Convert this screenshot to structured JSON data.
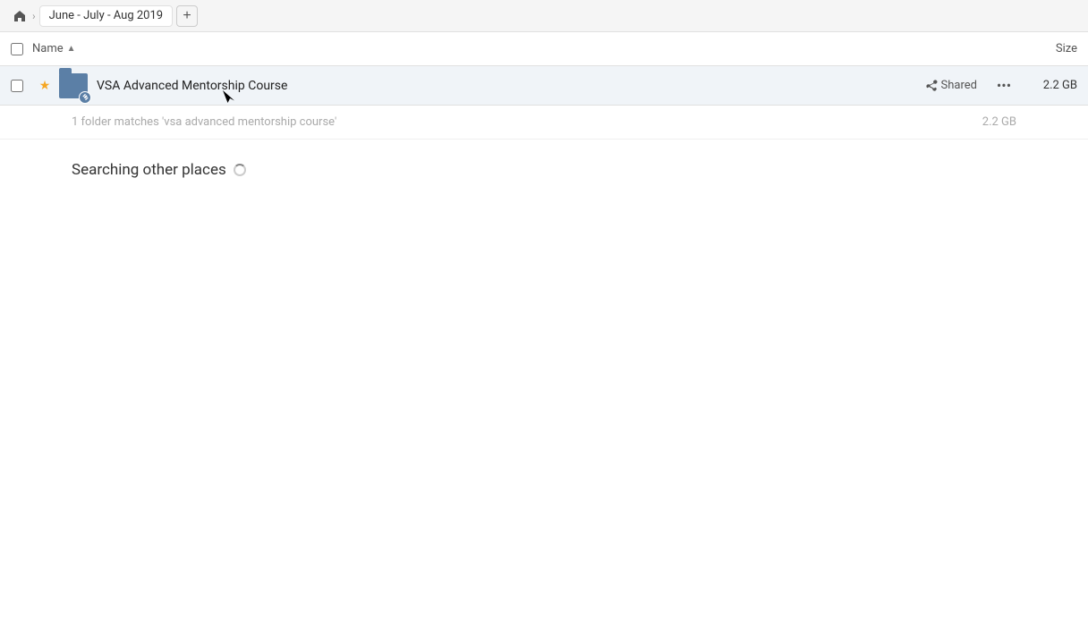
{
  "breadcrumb": {
    "home_icon": "🏠",
    "chevron": "›",
    "tab_label": "June - July - Aug 2019",
    "add_icon": "+"
  },
  "columns": {
    "name_label": "Name",
    "sort_icon": "▲",
    "size_label": "Size"
  },
  "file_row": {
    "star_icon": "★",
    "folder_name": "VSA Advanced Mentorship Course",
    "shared_label": "Shared",
    "more_icon": "···",
    "file_size": "2.2 GB"
  },
  "match_info": {
    "text": "1 folder matches 'vsa advanced mentorship course'",
    "size": "2.2 GB"
  },
  "searching": {
    "label": "Searching other places"
  },
  "colors": {
    "folder_bg": "#5b7fa6",
    "accent": "#f5a623"
  }
}
